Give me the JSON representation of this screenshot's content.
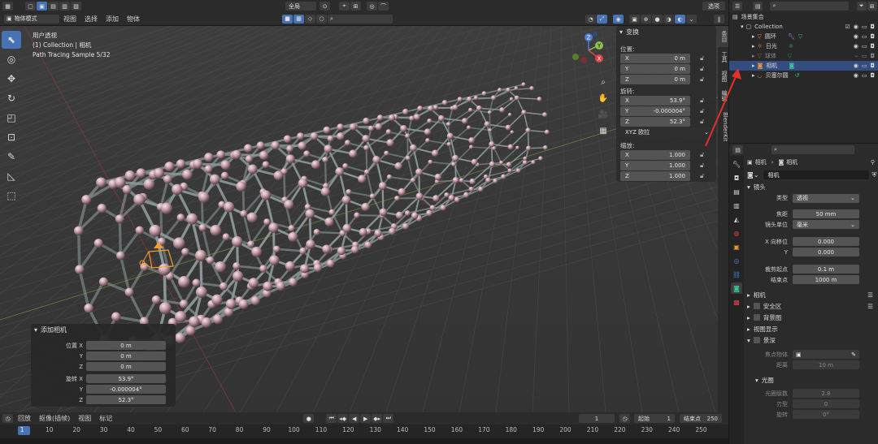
{
  "top_bar": {
    "transform_space": "全局",
    "options_label": "选项"
  },
  "view_header": {
    "mode": "物体模式",
    "menus": [
      "视图",
      "选择",
      "添加",
      "物体"
    ]
  },
  "viewport": {
    "view_name": "用户透视",
    "collection_line": "(1) Collection | 相机",
    "render_status": "Path Tracing Sample 5/32",
    "gizmo": {
      "z": "Z",
      "y": "Y",
      "x": "X"
    }
  },
  "n_panel": {
    "section": "变换",
    "location_label": "位置:",
    "location": [
      {
        "axis": "X",
        "value": "0 m"
      },
      {
        "axis": "Y",
        "value": "0 m"
      },
      {
        "axis": "Z",
        "value": "0 m"
      }
    ],
    "rotation_label": "旋转:",
    "rotation": [
      {
        "axis": "X",
        "value": "53.9°"
      },
      {
        "axis": "Y",
        "value": "-0.000004°"
      },
      {
        "axis": "Z",
        "value": "52.3°"
      }
    ],
    "rotation_mode": "XYZ 欧拉",
    "scale_label": "缩放:",
    "scale": [
      {
        "axis": "X",
        "value": "1.000"
      },
      {
        "axis": "Y",
        "value": "1.000"
      },
      {
        "axis": "Z",
        "value": "1.000"
      }
    ],
    "tabs": [
      "条目",
      "工具",
      "视图",
      "编辑",
      "BlenderKit"
    ]
  },
  "op_panel": {
    "title": "添加相机",
    "location_label": "位置 X",
    "location": [
      "0 m",
      "0 m",
      "0 m"
    ],
    "rotation_label": "旋转 X",
    "rotation": [
      "53.9°",
      "-0.000004°",
      "52.3°"
    ],
    "axis_y": "Y",
    "axis_z": "Z"
  },
  "timeline": {
    "menus": [
      "回放",
      "抠像(插帧)",
      "视图",
      "标记"
    ],
    "current_frame": "1",
    "start_label": "起始",
    "start": "1",
    "end_label": "结束点",
    "end": "250",
    "ruler": [
      "1",
      "10",
      "20",
      "30",
      "40",
      "50",
      "60",
      "70",
      "80",
      "90",
      "100",
      "110",
      "120",
      "130",
      "140",
      "150",
      "160",
      "170",
      "180",
      "190",
      "200",
      "210",
      "220",
      "230",
      "240",
      "250"
    ]
  },
  "outliner": {
    "scene_collection": "场景集合",
    "collection": "Collection",
    "items": [
      {
        "name": "圆环",
        "icon_color": "#e8963c"
      },
      {
        "name": "日光",
        "icon_color": "#e8963c"
      },
      {
        "name": "球体",
        "icon_color": "#e8963c"
      },
      {
        "name": "相机",
        "icon_color": "#e8963c"
      },
      {
        "name": "贝塞尔圆",
        "icon_color": "#e8963c"
      }
    ]
  },
  "properties": {
    "breadcrumb_object": "相机",
    "breadcrumb_data": "相机",
    "datablock": "相机",
    "lens_section": "镜头",
    "type_label": "类型",
    "type_value": "透视",
    "focal_label": "焦距",
    "focal_value": "50 mm",
    "lens_unit_label": "镜头单位",
    "lens_unit_value": "毫米",
    "shift_x_label": "X 向移位",
    "shift_x_value": "0.000",
    "shift_y_label": "Y",
    "shift_y_value": "0.000",
    "clip_start_label": "裁剪起点",
    "clip_start_value": "0.1 m",
    "clip_end_label": "结束点",
    "clip_end_value": "1000 m",
    "camera_section": "相机",
    "safe_areas": "安全区",
    "background_images": "背景图",
    "viewport_display": "视图显示",
    "dof_section": "景深",
    "focus_object_label": "焦点物体",
    "distance_label": "距离",
    "distance_value": "10 m",
    "aperture_section": "光圈",
    "fstop_label": "光圈级数",
    "fstop_value": "2.8",
    "blades_label": "刃型",
    "blades_value": "0",
    "rotation_label": "旋转",
    "rotation_value": "0°"
  },
  "colors": {
    "accent": "#4772b3",
    "selected_row": "#334d80",
    "atom": "#c9a3ad",
    "annotation_arrow": "#e0312b"
  }
}
